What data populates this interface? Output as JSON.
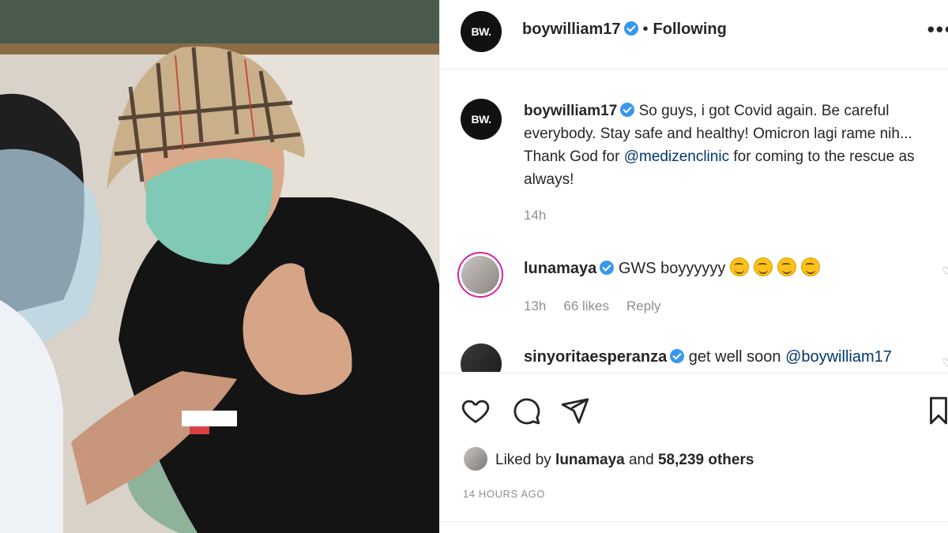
{
  "post": {
    "username": "boywilliam17",
    "following_label": "Following",
    "avatar_label": "BW.",
    "more_label": "•••"
  },
  "caption": {
    "username": "boywilliam17",
    "text_before": "So guys, i got Covid again. Be careful everybody. Stay safe and healthy! Omicron lagi rame nih... Thank God for ",
    "mention": "@medizenclinic",
    "text_after": " for coming to the rescue as always!",
    "time": "14h"
  },
  "comments": [
    {
      "username": "lunamaya",
      "text": "GWS boyyyyyy",
      "emoji_count": 4,
      "time": "13h",
      "likes": "66 likes",
      "reply_label": "Reply"
    },
    {
      "username": "sinyoritaesperanza",
      "text": "get well soon ",
      "mention": "@boywilliam17"
    }
  ],
  "likes": {
    "prefix": "Liked by ",
    "user": "lunamaya",
    "middle": " and ",
    "count": "58,239 others"
  },
  "timestamp": "14 HOURS AGO",
  "icons": [
    "heart-icon",
    "comment-icon",
    "share-icon",
    "bookmark-icon",
    "verified-badge-icon"
  ],
  "colors": {
    "verified": "#3897f0",
    "mention": "#00376b",
    "muted": "#8e8e8e"
  }
}
